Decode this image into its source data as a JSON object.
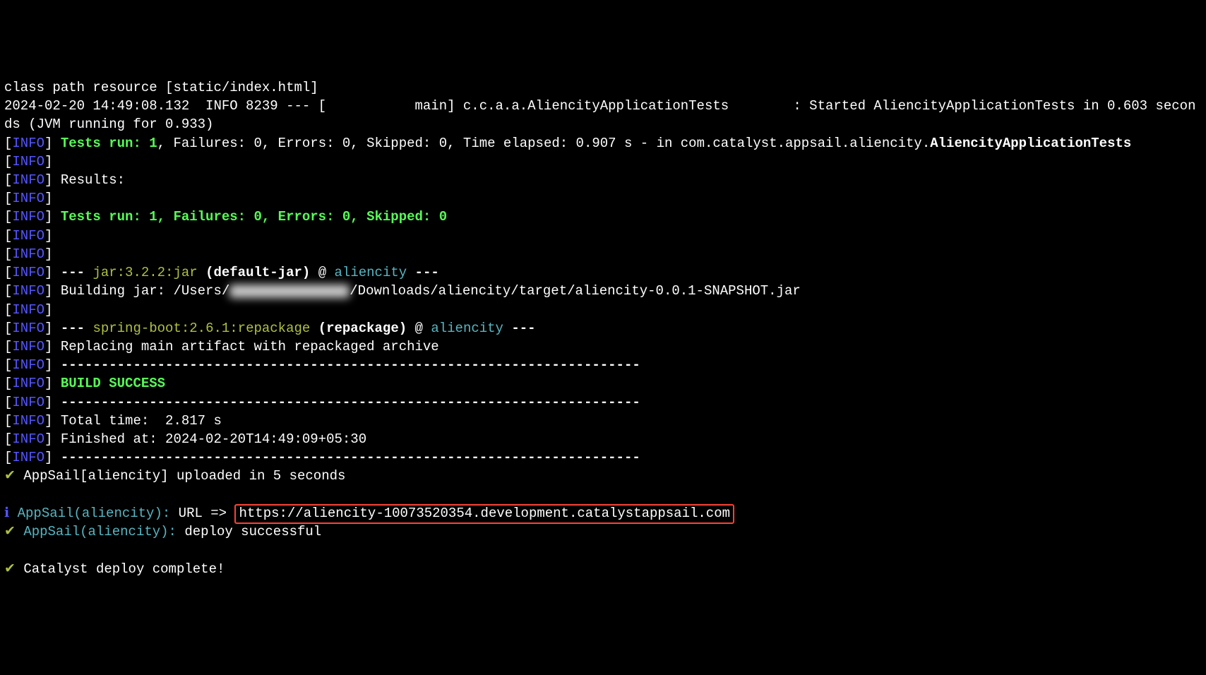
{
  "l0": "class path resource [static/index.html]",
  "l1": "2024-02-20 14:49:08.132  INFO 8239 --- [           main] c.c.a.a.AliencityApplicationTests        : Started AliencityApplicationTests in 0.603 seconds (JVM running for 0.933)",
  "info_tag": "INFO",
  "tests_run_line": " Tests run: 1",
  "tests_rest": ", Failures: 0, Errors: 0, Skipped: 0, Time elapsed: 0.907 s - in com.catalyst.appsail.aliencity.",
  "tests_class": "AliencityApplicationTests",
  "results_label": " Results:",
  "tests_summary": " Tests run: 1, Failures: 0, Errors: 0, Skipped: 0",
  "dashes3": " --- ",
  "jar_plugin": "jar:3.2.2:jar",
  "jar_goal": " (default-jar)",
  "at": " @ ",
  "project": "aliencity",
  "dashes_end": " ---",
  "build_jar_pre": " Building jar: /Users/",
  "build_jar_post": "/Downloads/aliencity/target/aliencity-0.0.1-SNAPSHOT.jar",
  "spring_plugin": "spring-boot:2.6.1:repackage",
  "spring_goal": " (repackage)",
  "replace_line": " Replacing main artifact with repackaged archive",
  "hr": " ------------------------------------------------------------------------",
  "build_success": " BUILD SUCCESS",
  "total_time": " Total time:  2.817 s",
  "finished_at": " Finished at: 2024-02-20T14:49:09+05:30",
  "check": "✔",
  "info_i": "ℹ",
  "upload_line": " AppSail[aliencity] uploaded in 5 seconds",
  "appsail_tag": " AppSail(aliencity):",
  "url_label": " URL => ",
  "url": "https://aliencity-10073520354.development.catalystappsail.com",
  "deploy_ok": " deploy successful",
  "deploy_complete": " Catalyst deploy complete!"
}
